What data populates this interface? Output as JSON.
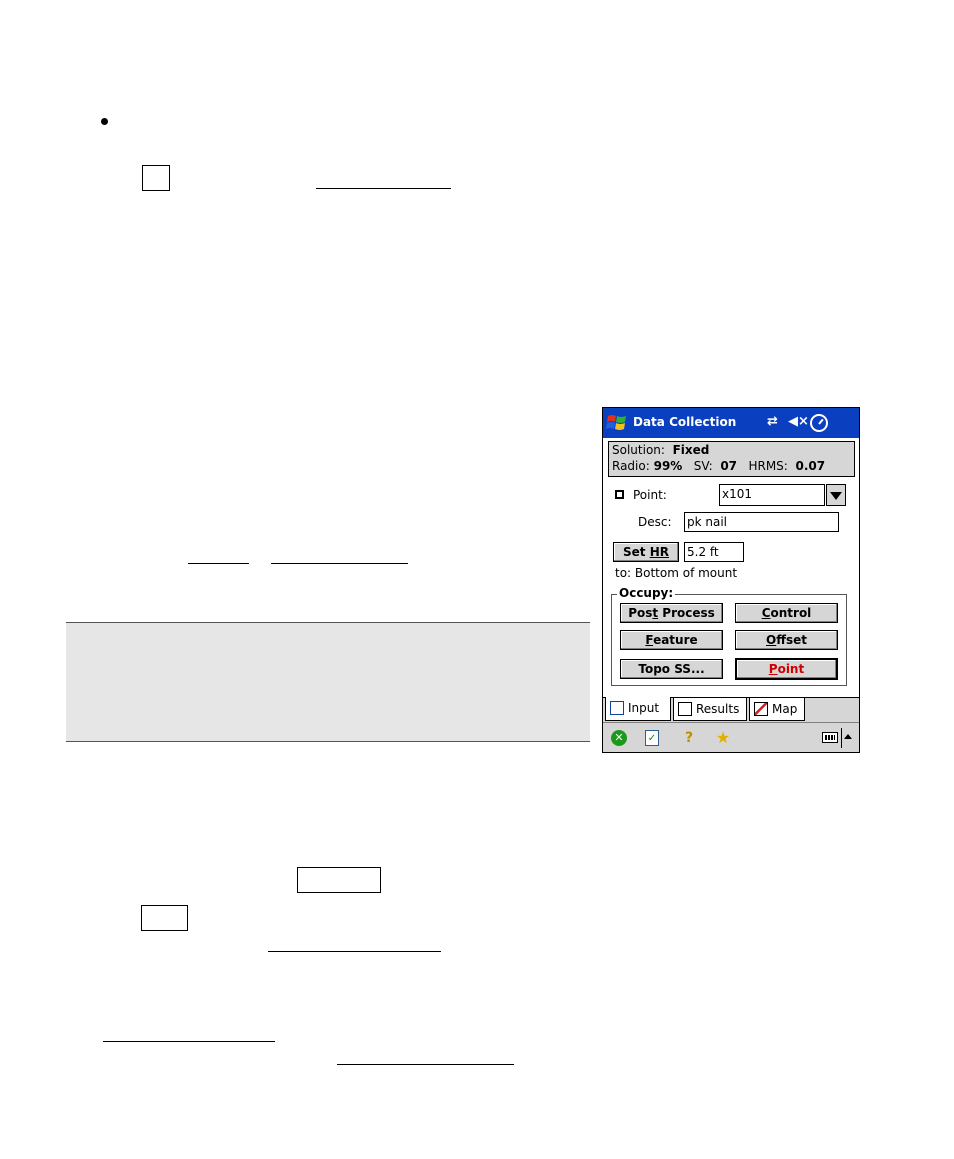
{
  "pda": {
    "title": "Data Collection",
    "status": {
      "solution_label": "Solution:",
      "solution_value": "Fixed",
      "radio_label": "Radio:",
      "radio_value": "99%",
      "sv_label": "SV:",
      "sv_value": "07",
      "hrms_label": "HRMS:",
      "hrms_value": "0.07"
    },
    "point_label": "Point:",
    "point_value": "x101",
    "desc_label": "Desc:",
    "desc_value": "pk nail",
    "set_hr_prefix": "Set ",
    "set_hr_underlined": "HR",
    "hr_value": "5.2 ft",
    "to_text": "to: Bottom of mount",
    "occupy_label": "Occupy:",
    "buttons": {
      "post_process_a": "Pos",
      "post_process_u": "t",
      "post_process_b": " Process",
      "control_u": "C",
      "control_rest": "ontrol",
      "feature_u": "F",
      "feature_rest": "eature",
      "offset_u": "O",
      "offset_rest": "ffset",
      "topo": "Topo SS...",
      "point_u": "P",
      "point_rest": "oint"
    },
    "tabs": [
      "Input",
      "Results",
      "Map"
    ]
  },
  "colors": {
    "titlebar": "#0a3fc0",
    "point_button_text": "#d00000",
    "note_background": "#e6e6e6"
  }
}
